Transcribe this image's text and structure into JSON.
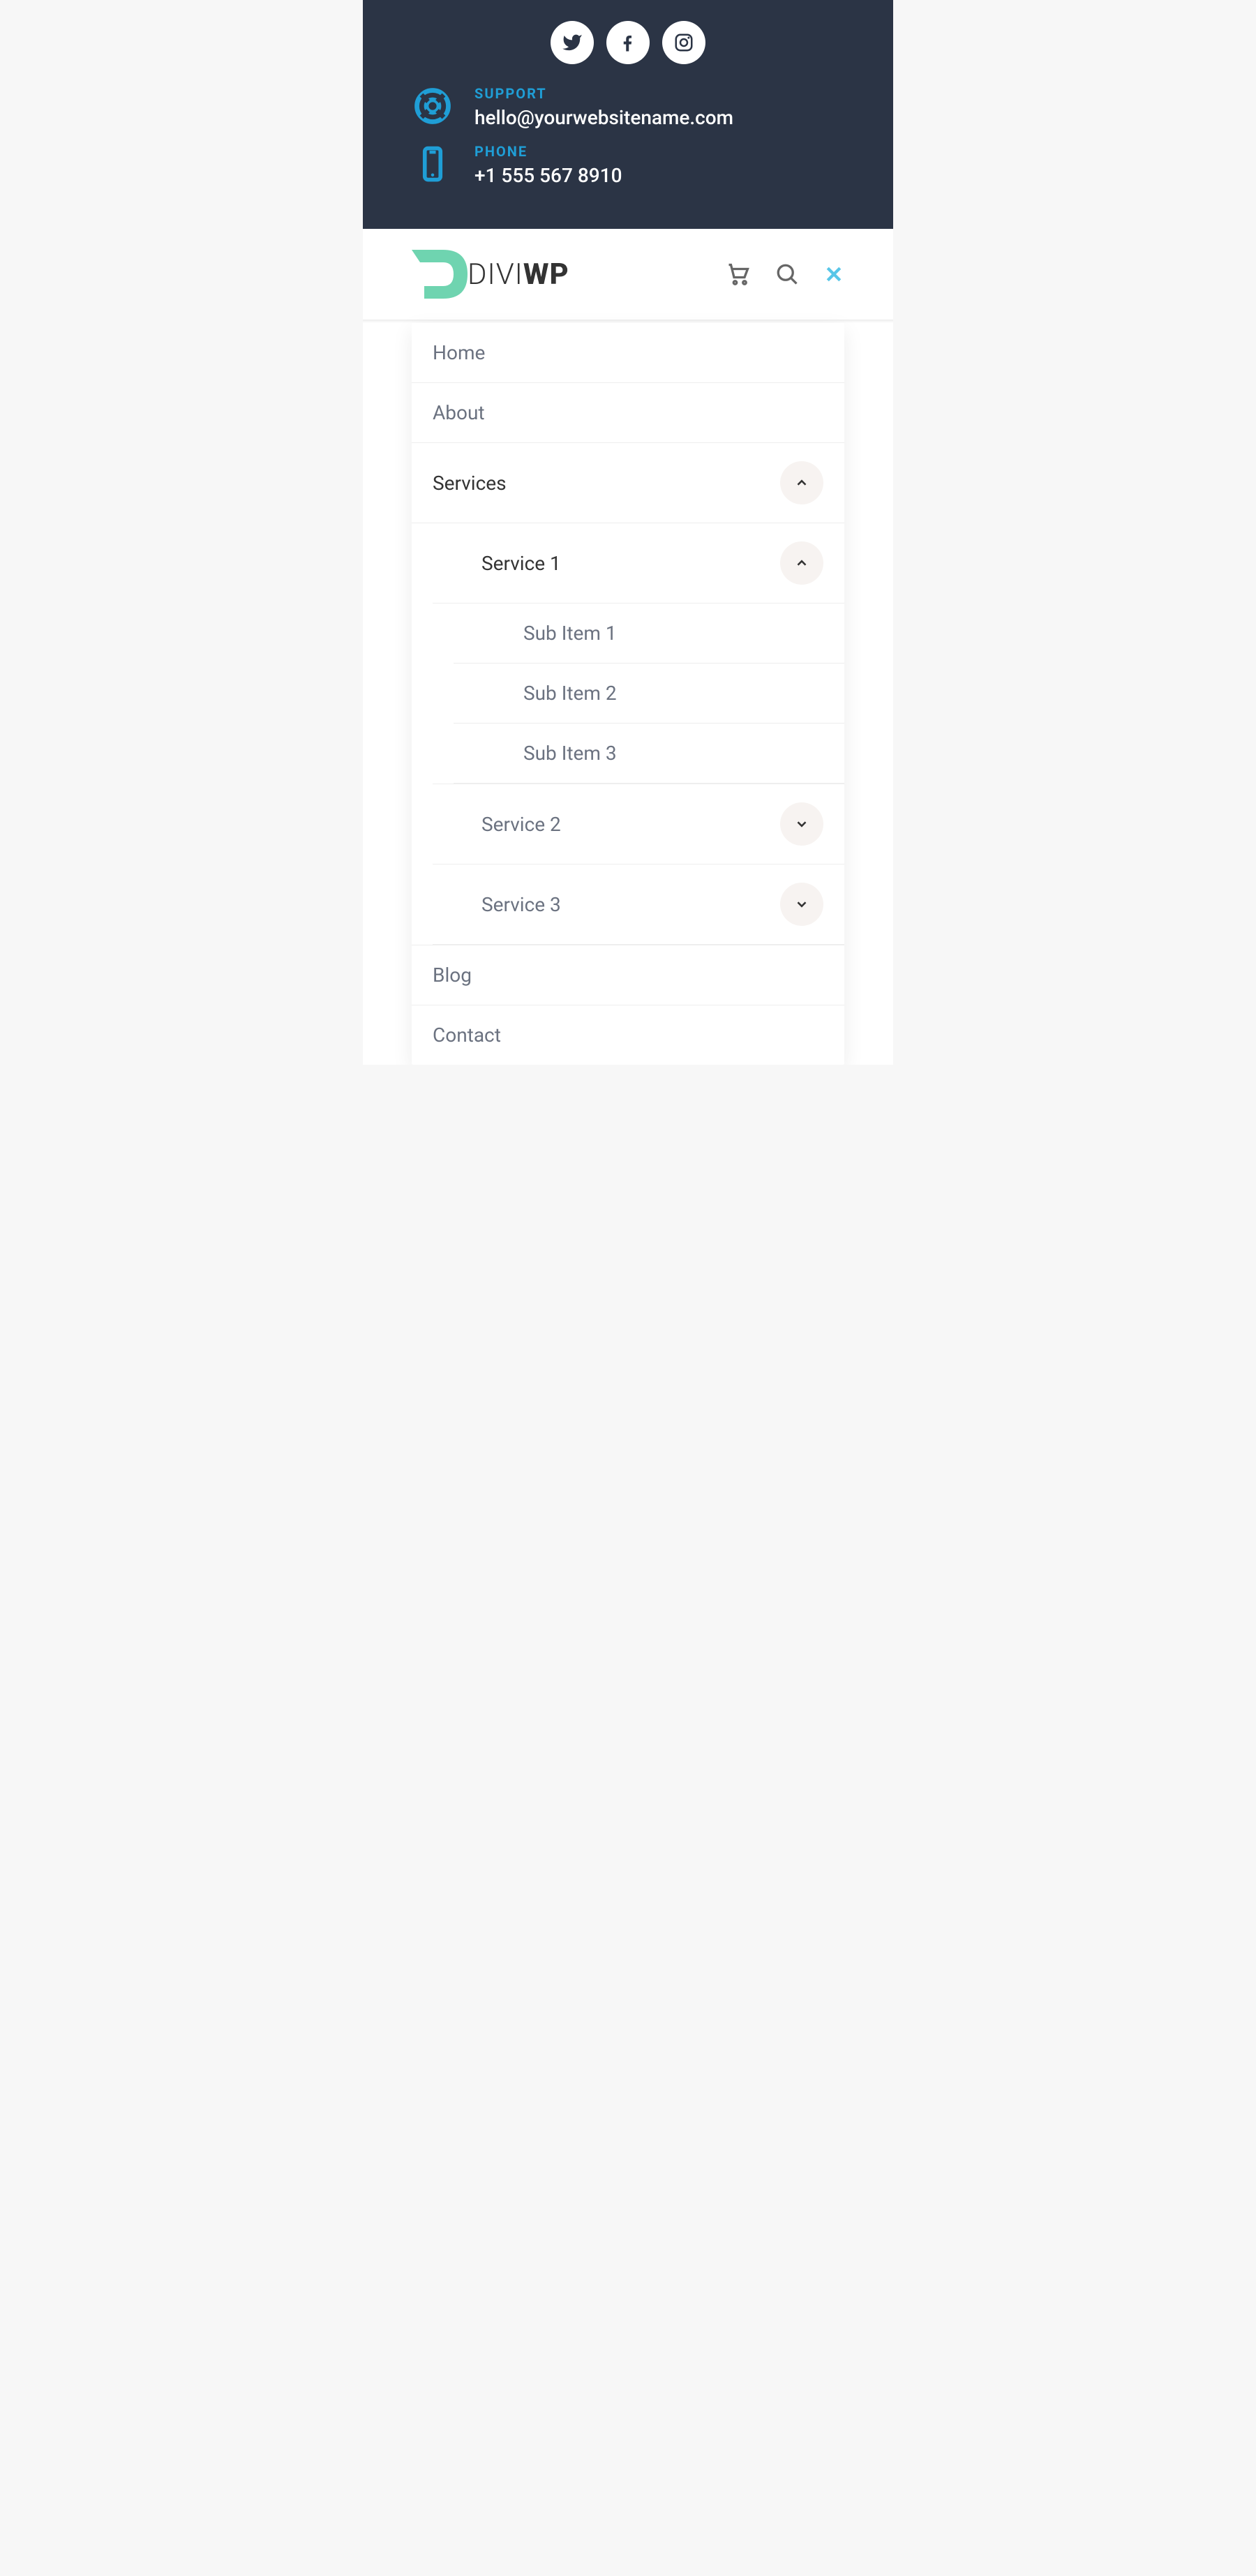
{
  "topbar": {
    "support_label": "SUPPORT",
    "support_value": "hello@yourwebsitename.com",
    "phone_label": "PHONE",
    "phone_value": "+1 555 567 8910"
  },
  "logo": {
    "text_light": "DIVI",
    "text_bold": "WP"
  },
  "menu": {
    "home": "Home",
    "about": "About",
    "services": "Services",
    "service1": "Service 1",
    "sub1": "Sub Item 1",
    "sub2": "Sub Item 2",
    "sub3": "Sub Item 3",
    "service2": "Service 2",
    "service3": "Service 3",
    "blog": "Blog",
    "contact": "Contact"
  }
}
